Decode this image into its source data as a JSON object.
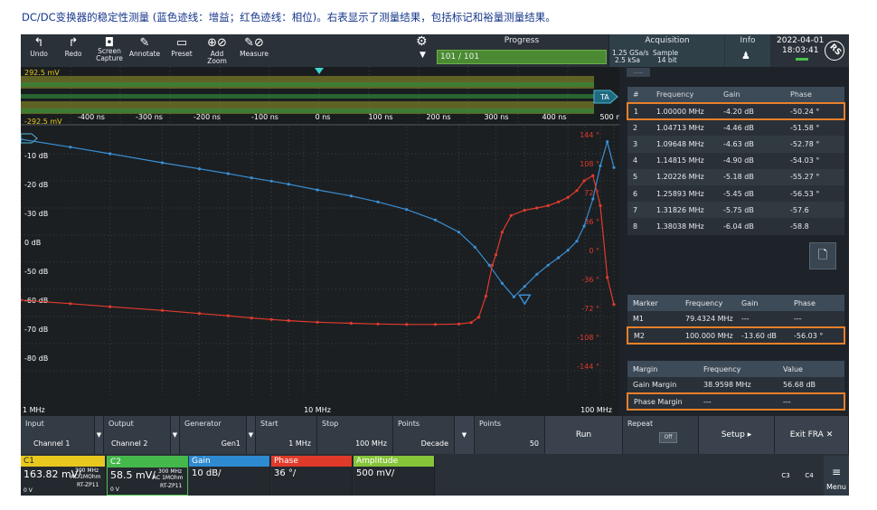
{
  "caption": "DC/DC变换器的稳定性测量 (蓝色迹线：增益；红色迹线：相位)。右表显示了测量结果，包括标记和裕量测量结果。",
  "toolbar": {
    "undo": "Undo",
    "redo": "Redo",
    "screen_capture": "Screen Capture",
    "annotate": "Annotate",
    "preset": "Preset",
    "add_zoom": "Add Zoom",
    "measure": "Measure",
    "progress_title": "Progress",
    "progress_value": "101 / 101",
    "acq_title": "Acquisition",
    "acq_rate": "1.25 GSa/s",
    "acq_len": "2.5 kSa",
    "acq_mode": "Sample",
    "acq_bits": "14 bit",
    "info_title": "Info",
    "date": "2022-04-01",
    "time": "18:03:41",
    "colors": {
      "progress": "#4b8a33",
      "accent": "#e8802a"
    }
  },
  "waveform": {
    "top_label": "292.5 mV",
    "bottom_label": "-292.5 mV",
    "tag": "TA",
    "ticks": [
      "-400 ns",
      "-300 ns",
      "-200 ns",
      "-100 ns",
      "0 ns",
      "100 ns",
      "200 ns",
      "300 ns",
      "400 ns",
      "500 ns"
    ]
  },
  "chart_data": {
    "type": "line",
    "x_scale": "log",
    "x_ticks": [
      "1 MHz",
      "10 MHz",
      "100 MHz"
    ],
    "left_ticks": [
      "-10 dB",
      "-20 dB",
      "-30 dB",
      "0 dB",
      "-50 dB",
      "-60 dB",
      "-70 dB",
      "-80 dB"
    ],
    "right_ticks": [
      "144 °",
      "108 °",
      "72 °",
      "36 °",
      "0 °",
      "-36 °",
      "-72 °",
      "-108 °",
      "-144 °"
    ],
    "left_axis": {
      "unit": "dB",
      "range": [
        -90,
        0
      ]
    },
    "right_axis": {
      "unit": "°",
      "range": [
        -180,
        180
      ]
    },
    "series": [
      {
        "name": "Gain",
        "color": "#3a8fd4",
        "x": [
          1.0,
          1.47,
          2.0,
          3.0,
          4.0,
          5.0,
          6.0,
          7.0,
          8.0,
          10.0,
          13.0,
          16.0,
          20.0,
          25.0,
          30.0,
          34.0,
          38.0,
          42.0,
          46.0,
          50.0,
          55.0,
          60.0,
          65.0,
          70.0,
          75.0,
          79.4,
          85.0,
          90.0,
          95.0,
          100.0
        ],
        "y": [
          -4.2,
          -6.8,
          -9.0,
          -12.0,
          -14.0,
          -15.6,
          -17.0,
          -18.1,
          -19.1,
          -21.0,
          -23.0,
          -25.0,
          -27.5,
          -31.0,
          -35.0,
          -40.0,
          -46.0,
          -52.0,
          -56.5,
          -53.0,
          -49.0,
          -46.0,
          -43.5,
          -41.0,
          -38.0,
          -33.0,
          -24.0,
          -13.0,
          -5.0,
          -13.6
        ]
      },
      {
        "name": "Phase",
        "color": "#e33a2c",
        "x": [
          1.0,
          1.47,
          2.0,
          3.0,
          4.0,
          5.0,
          6.0,
          7.0,
          8.0,
          10.0,
          13.0,
          16.0,
          20.0,
          25.0,
          30.0,
          33.0,
          35.0,
          37.0,
          38.9,
          40.0,
          42.0,
          45.0,
          50.0,
          55.0,
          60.0,
          65.0,
          70.0,
          75.0,
          79.4,
          85.0,
          90.0,
          95.0,
          100.0
        ],
        "y": [
          -50.2,
          -55.0,
          -59.0,
          -64.0,
          -68.0,
          -71.0,
          -74.0,
          -76.0,
          -77.5,
          -79.5,
          -81.0,
          -82.0,
          -82.5,
          -82.5,
          -82.0,
          -80.0,
          -73.0,
          -45.0,
          -4.0,
          10.0,
          40.0,
          62.0,
          69.0,
          72.0,
          75.0,
          80.0,
          86.0,
          95.0,
          108.0,
          115.0,
          75.0,
          -20.0,
          -56.0
        ]
      }
    ]
  },
  "results": {
    "headers": [
      "#",
      "Frequency",
      "Gain",
      "Phase"
    ],
    "rows": [
      [
        "1",
        "1.00000 MHz",
        "-4.20 dB",
        "-50.24 °"
      ],
      [
        "2",
        "1.04713 MHz",
        "-4.46 dB",
        "-51.58 °"
      ],
      [
        "3",
        "1.09648 MHz",
        "-4.63 dB",
        "-52.78 °"
      ],
      [
        "4",
        "1.14815 MHz",
        "-4.90 dB",
        "-54.03 °"
      ],
      [
        "5",
        "1.20226 MHz",
        "-5.18 dB",
        "-55.27 °"
      ],
      [
        "6",
        "1.25893 MHz",
        "-5.45 dB",
        "-56.53 °"
      ],
      [
        "7",
        "1.31826 MHz",
        "-5.75 dB",
        "-57.6"
      ],
      [
        "8",
        "1.38038 MHz",
        "-6.04 dB",
        "-58.8"
      ]
    ]
  },
  "markers": {
    "headers": [
      "Marker",
      "Frequency",
      "Gain",
      "Phase"
    ],
    "rows": [
      [
        "M1",
        "79.4324 MHz",
        "---",
        "---"
      ],
      [
        "M2",
        "100.000 MHz",
        "-13.60 dB",
        "-56.03 °"
      ]
    ]
  },
  "margins": {
    "headers": [
      "Margin",
      "Frequency",
      "Value"
    ],
    "rows": [
      [
        "Gain Margin",
        "38.9598 MHz",
        "56.68 dB"
      ],
      [
        "Phase Margin",
        "---",
        "---"
      ]
    ]
  },
  "controls": {
    "input_label": "Input",
    "input_value": "Channel 1",
    "output_label": "Output",
    "output_value": "Channel 2",
    "generator_label": "Generator",
    "generator_value": "Gen1",
    "start_label": "Start",
    "start_value": "1 MHz",
    "stop_label": "Stop",
    "stop_value": "100 MHz",
    "points_label": "Points",
    "points_value": "Decade",
    "points2_label": "Points",
    "points2_value": "50",
    "run": "Run",
    "repeat_label": "Repeat",
    "repeat_value": "Off",
    "setup": "Setup",
    "exit": "Exit FRA"
  },
  "channels": {
    "c1": {
      "name": "C1",
      "value": "163.82 mV/",
      "bw": "300 MHz",
      "coupling": "AC 1MOhm",
      "probe": "RT-ZP11",
      "offset": "0 V"
    },
    "c2": {
      "name": "C2",
      "value": "58.5 mV/",
      "bw": "300 MHz",
      "coupling": "AC 1MOhm",
      "probe": "RT-ZP11",
      "offset": "0 V"
    },
    "gain": {
      "name": "Gain",
      "value": "10 dB/"
    },
    "phase": {
      "name": "Phase",
      "value": "36 °/"
    },
    "amplitude": {
      "name": "Amplitude",
      "value": "500 mV/"
    },
    "c3": "C3",
    "c4": "C4",
    "menu": "Menu"
  }
}
